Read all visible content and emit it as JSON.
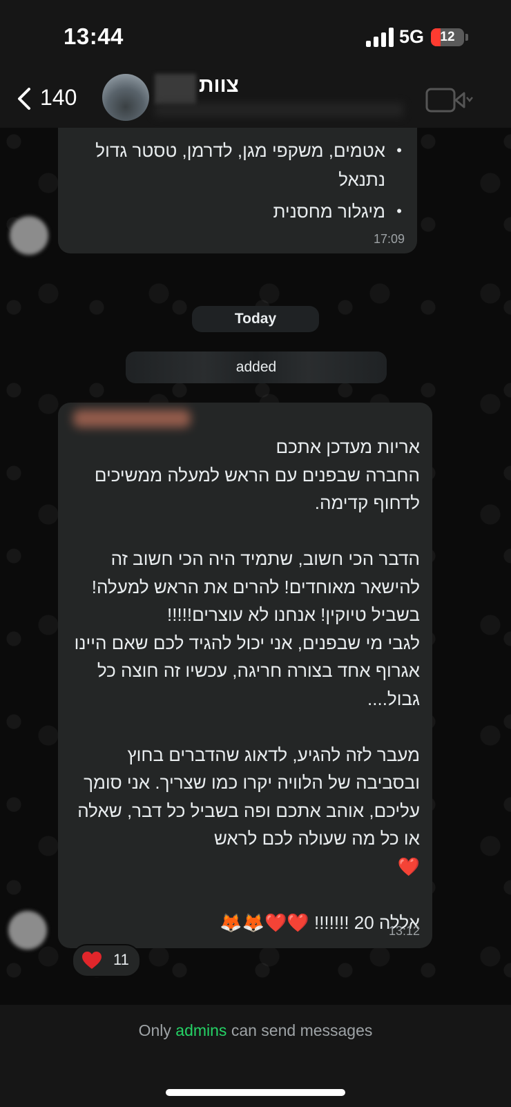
{
  "status_bar": {
    "time": "13:44",
    "network": "5G",
    "battery": "12"
  },
  "header": {
    "back_count": "140",
    "title": "צוות"
  },
  "messages": {
    "prev_bullets": [
      "אטמים, משקפי מגן, לדרמן, טסטר גדול",
      "מיגלור מחסנית"
    ],
    "prev_bullet_cont": "נתנאל",
    "prev_time": "17:09",
    "date_label": "Today",
    "system_added": "added",
    "main_text": "אריות מעדכן אתכם\nהחברה שבפנים עם הראש למעלה ממשיכים לדחוף קדימה.\n\nהדבר הכי חשוב, שתמיד היה הכי חשוב זה להישאר מאוחדים! להרים את הראש למעלה! בשביל טיוקין! אנחנו לא עוצרים!!!!!\nלגבי מי שבפנים, אני יכול להגיד לכם שאם היינו אגרוף אחד בצורה חריגה, עכשיו זה חוצה כל גבול....\n\nמעבר לזה להגיע, לדאוג שהדברים בחוץ ובסביבה של הלוויה יקרו כמו שצריך. אני סומך עליכם, אוהב אתכם ופה בשביל כל דבר, שאלה או כל מה שעולה לכם לראש\n❤️\n\nאללה 20 !!!!!!! ❤️❤️🦊🦊",
    "main_time": "13:12",
    "reaction_count": "11"
  },
  "footer": {
    "prefix": "Only",
    "highlight": "admins",
    "suffix": "can send messages"
  },
  "colors": {
    "accent_green": "#25d366",
    "bubble": "#242626",
    "background": "#0b0b0b"
  },
  "icons": [
    "back-chevron-icon",
    "video-call-icon",
    "heart-icon",
    "signal-icon",
    "battery-icon"
  ]
}
